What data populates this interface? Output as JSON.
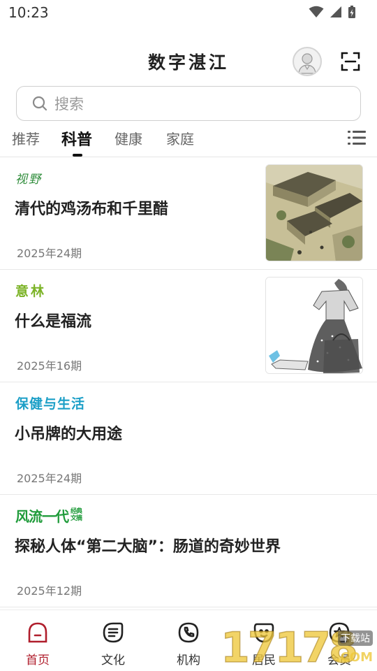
{
  "status_bar": {
    "time": "10:23",
    "icons": [
      "wifi-icon",
      "signal-icon",
      "battery-charging-icon"
    ]
  },
  "header": {
    "title": "数字湛江",
    "avatar_icon": "user-avatar-icon",
    "scan_icon": "scan-icon"
  },
  "search": {
    "placeholder": "搜索",
    "icon": "search-icon"
  },
  "tabs": {
    "items": [
      {
        "label": "推荐",
        "active": false
      },
      {
        "label": "科普",
        "active": true
      },
      {
        "label": "健康",
        "active": false
      },
      {
        "label": "家庭",
        "active": false
      }
    ],
    "menu_icon": "list-menu-icon"
  },
  "articles": [
    {
      "magazine": "视野",
      "title": "清代的鸡汤布和千里醋",
      "issue": "2025年24期",
      "thumbnail": "historical-painting-thumbnail"
    },
    {
      "magazine": "意林",
      "title": "什么是福流",
      "issue": "2025年16期",
      "thumbnail": "illustrated-figure-thumbnail"
    },
    {
      "magazine": "保健与生活",
      "title": "小吊牌的大用途",
      "issue": "2025年24期"
    },
    {
      "magazine": "风流一代",
      "magazine_sub": "经典文摘",
      "title": "探秘人体“第二大脑”：肠道的奇妙世界",
      "issue": "2025年12期"
    }
  ],
  "bottom_nav": {
    "items": [
      {
        "label": "首页",
        "icon": "home-icon",
        "active": true
      },
      {
        "label": "文化",
        "icon": "culture-icon",
        "active": false
      },
      {
        "label": "机构",
        "icon": "phone-icon",
        "active": false
      },
      {
        "label": "居民",
        "icon": "resident-icon",
        "active": false
      },
      {
        "label": "会员",
        "icon": "member-icon",
        "active": false
      }
    ]
  },
  "watermark": {
    "digits": "17178",
    "badge": "下载站",
    "suffix": ".COM"
  },
  "colors": {
    "accent": "#b01e2c",
    "text": "#222222",
    "muted": "#777777",
    "logo_shiye": "#2e8c3a",
    "logo_yilin": "#7cb327",
    "logo_baojian": "#1c9fc7",
    "logo_fengliu": "#1f9b3a"
  }
}
